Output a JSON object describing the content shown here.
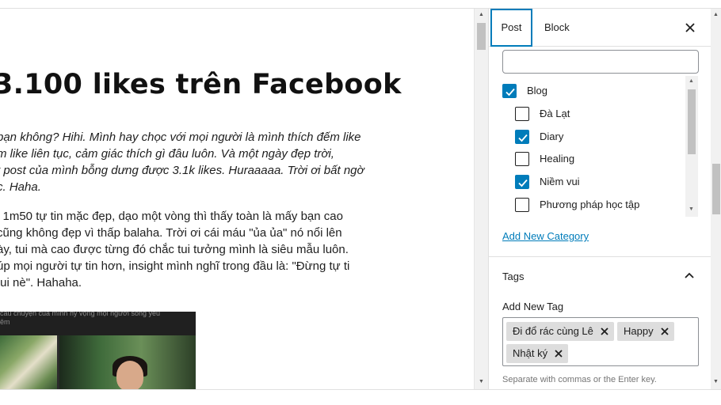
{
  "post": {
    "title": "3.100 likes trên Facebook",
    "paragraph1": [
      "bạn không? Hihi. Mình hay chọc với mọi người là mình thích đếm like",
      "m like liên tục, cảm giác thích gì đâu luôn. Và một ngày đẹp trời,",
      "t post của mình bỗng dưng được 3.1k likes. Huraaaaa. Trời ơi bất ngờ",
      "c. Haha."
    ],
    "paragraph2": [
      "i 1m50 tự tin mặc đẹp, dạo một vòng thì thấy toàn là mấy bạn cao",
      "cũng không đẹp vì thấp balaha. Trời ơi cái máu \"ủa ủa\" nó nổi lên",
      "ày, tui mà cao được từng đó chắc tui tưởng mình là siêu mẫu luôn.",
      "úp mọi người tự tin hơn, insight mình nghĩ trong đầu là: \"Đừng tự ti",
      "tui nè\". Hahaha."
    ],
    "image_caption": [
      "câu chuyện của mình hy vọng mọi người sống yêu",
      "êm"
    ]
  },
  "sidebar": {
    "tabs": {
      "post": "Post",
      "block": "Block"
    },
    "categories": [
      {
        "label": "Blog",
        "checked": true,
        "level": 0
      },
      {
        "label": "Đà Lạt",
        "checked": false,
        "level": 1
      },
      {
        "label": "Diary",
        "checked": true,
        "level": 1
      },
      {
        "label": "Healing",
        "checked": false,
        "level": 1
      },
      {
        "label": "Niềm vui",
        "checked": true,
        "level": 1
      },
      {
        "label": "Phương pháp học tập",
        "checked": false,
        "level": 1
      }
    ],
    "add_category": "Add New Category",
    "tags_heading": "Tags",
    "add_tag_label": "Add New Tag",
    "tags": [
      "Đi đổ rác cùng Lê",
      "Happy",
      "Nhật ký"
    ],
    "tag_help": "Separate with commas or the Enter key."
  },
  "colors": {
    "accent": "#007cba",
    "token_bg": "#dddddd"
  }
}
